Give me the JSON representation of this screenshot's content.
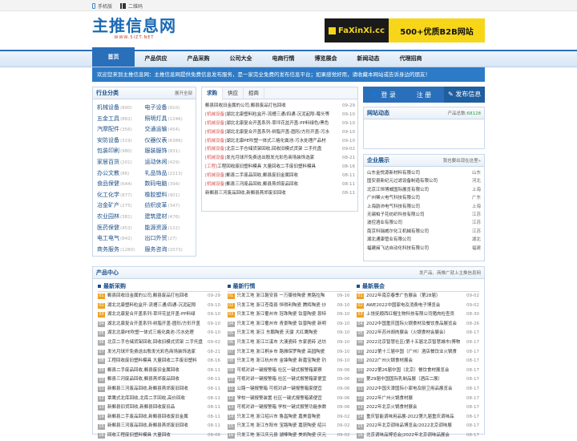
{
  "topbar": {
    "mobile": "手机版",
    "qrcode": "二维码"
  },
  "logo": {
    "title": "主推信息网",
    "sub": "WWW.5IZT.NET"
  },
  "ad": {
    "brand": "FaXinXi.cc",
    "text": "500+优质B2B网站"
  },
  "nav": [
    "首页",
    "产品供应",
    "产品采购",
    "公司大全",
    "电商行情",
    "博览展会",
    "新闻动态",
    "代理招商"
  ],
  "notice": "欢迎您来到主推信息网：主推信息网提供免费信息发布服务，是一家完全免费的发布信息平台；如果感觉好用，请收藏本网站或告诉身边的朋友！",
  "category": {
    "title": "行业分类",
    "more": "展开全部",
    "items": [
      {
        "n": "机械设备",
        "c": "(800)"
      },
      {
        "n": "电子设备",
        "c": "(910)"
      },
      {
        "n": "五金工具",
        "c": "(882)"
      },
      {
        "n": "照明灯具",
        "c": "(1246)"
      },
      {
        "n": "汽摩配件",
        "c": "(356)"
      },
      {
        "n": "交通运输",
        "c": "(454)"
      },
      {
        "n": "安防设备",
        "c": "(319)"
      },
      {
        "n": "仪器仪表",
        "c": "(6386)"
      },
      {
        "n": "包装印刷",
        "c": "(980)"
      },
      {
        "n": "服装服饰",
        "c": "(831)"
      },
      {
        "n": "家居百货",
        "c": "(201)"
      },
      {
        "n": "运动休闲",
        "c": "(429)"
      },
      {
        "n": "办公文教",
        "c": "(86)"
      },
      {
        "n": "礼品饰品",
        "c": "(2213)"
      },
      {
        "n": "食品保健",
        "c": "(644)"
      },
      {
        "n": "数码电脑",
        "c": "(394)"
      },
      {
        "n": "化工化学",
        "c": "(877)"
      },
      {
        "n": "橡胶塑料",
        "c": "(901)"
      },
      {
        "n": "冶金矿产",
        "c": "(275)"
      },
      {
        "n": "纺织皮革",
        "c": "(347)"
      },
      {
        "n": "农业园林",
        "c": "(381)"
      },
      {
        "n": "建筑建材",
        "c": "(476)"
      },
      {
        "n": "医药保健",
        "c": "(452)"
      },
      {
        "n": "能源资源",
        "c": "(122)"
      },
      {
        "n": "电工电气",
        "c": "(842)"
      },
      {
        "n": "出口外贸",
        "c": "(27)"
      },
      {
        "n": "商务服务",
        "c": "(1280)"
      },
      {
        "n": "服务咨询",
        "c": "(2073)"
      }
    ]
  },
  "middle": {
    "tabs": [
      "求购",
      "供应",
      "招商"
    ],
    "items": [
      {
        "tag": "",
        "t": "郵县回收旧金属的公司,郵县废品打包回收",
        "d": "09-29"
      },
      {
        "tag": "[机械设备]",
        "t": "湖北北康塑料粒盒开-流槽三通/四通-沉泥起隙-莓头等",
        "d": "09-10"
      },
      {
        "tag": "[机械设备]",
        "t": "湖北北康复合开盖系列-草坪花盆开盖-PP料绿色/黑色",
        "d": "09-10"
      },
      {
        "tag": "[机械设备]",
        "t": "湖北北康复合开盖系列-树脂开盖-圆形/方形开盖-污水",
        "d": "09-10"
      },
      {
        "tag": "[机械设备]",
        "t": "湖北北康PE吹塑一体式三格化粪池-污水处理产品材",
        "d": "09-10"
      },
      {
        "tag": "[机械设备]",
        "t": "北京二手仓储货架回收,回收旧模式货架  二手托盘",
        "d": "09-02"
      },
      {
        "tag": "[机械设备]",
        "t": "发光月球开免费送出殷发光彩色商场装饰选家",
        "d": "08-21"
      },
      {
        "tag": "[工程]",
        "t": "工程回收废旧塑料模具 大量回收二手废旧塑料模具",
        "d": "08-16"
      },
      {
        "tag": "[机械设备]",
        "t": "郵县二手废品回收,郵县废旧金属回收",
        "d": "08-11"
      },
      {
        "tag": "[机械设备]",
        "t": "郵县三河废品回收,郵县燕郊废品回收",
        "d": "08-11"
      },
      {
        "tag": "",
        "t": "新郵县三河废品回收,新郵县燕郊废旧回收",
        "d": "08-11"
      }
    ]
  },
  "right": {
    "login": "登 录",
    "register": "注 册",
    "publish": "发布信息",
    "dynamic": {
      "title": "网站动态",
      "count_label": "产品总数:",
      "count": "68128"
    },
    "enterprise": {
      "title": "企业展示",
      "more": "我也要出现在这里»",
      "items": [
        {
          "n": "山东金悦源新材料有限公司",
          "p": "山东"
        },
        {
          "n": "国安县新纪元过滤设备制造有限公司",
          "p": "河北"
        },
        {
          "n": "北京江恒博威国际展览有限公司",
          "p": "上海"
        },
        {
          "n": "广州稀火电气科技有限公司",
          "p": "广东"
        },
        {
          "n": "上海韵沛电气科技有限公司",
          "p": "上海"
        },
        {
          "n": "无锡柏子花纺织科技有限公司",
          "p": "江苏"
        },
        {
          "n": "波控酒业有限公司",
          "p": "江苏"
        },
        {
          "n": "南京科瑞威尔化工机械有限公司",
          "p": "江苏"
        },
        {
          "n": "湖北通康管业有限公司",
          "p": "湖北"
        },
        {
          "n": "福建闽飞达自动化科技有限公司",
          "p": "福建"
        }
      ]
    }
  },
  "products": {
    "title": "产品中心",
    "more": "发产品、商推广就上主推信息网",
    "cols": [
      {
        "title": "最新采购",
        "items": [
          {
            "t": "郵县回收旧金属的公司,郵县废品打包回收",
            "d": "09-29"
          },
          {
            "t": "湖北北康塑料粒盒开-流槽三通/四通-沉泥起隙",
            "d": "09-10"
          },
          {
            "t": "湖北北康复合开盖系列-草坪花盆开盖-PP料绿",
            "d": "09-10"
          },
          {
            "t": "湖北北康复合开盖系列-树脂开盖-圆形/方形开盖",
            "d": "09-10"
          },
          {
            "t": "湖北北康PE吹塑一体式三格化粪池-污水处理",
            "d": "09-10"
          },
          {
            "t": "北京二手仓储货架回收,回收旧模式货架  二手托盘",
            "d": "09-02"
          },
          {
            "t": "发光月球开免费送出殷发光彩色商场装饰选家",
            "d": "08-21"
          },
          {
            "t": "工程回收废旧塑料模具 大量回收二手废旧塑料",
            "d": "08-16"
          },
          {
            "t": "郵县二手废品回收,郵县废旧金属回收",
            "d": "08-11"
          },
          {
            "t": "郵县三河废品回收,郵县燕郊废品回收",
            "d": "08-11"
          },
          {
            "t": "新郵县三河废品回收,新郵县燕郊废旧回收",
            "d": "08-11"
          },
          {
            "t": "覃鹰式北库回收,北库二手回收,高价回收",
            "d": "08-11"
          },
          {
            "t": "新郵县旧货回收,新郵县回收废旧品",
            "d": "08-11"
          },
          {
            "t": "新郵县二手废品回收,新郵县回收废旧金属",
            "d": "08-11"
          },
          {
            "t": "新郵县三河废品回收,新郵县燕郊废旧回收",
            "d": "08-11"
          },
          {
            "t": "回收工程废旧塑料模具 大量回收",
            "d": "08-06"
          }
        ]
      },
      {
        "title": "最新行情",
        "items": [
          {
            "t": "只发工地 浙江磐安县 一万瓣技陶瓷 美路拉陶",
            "d": "09-16"
          },
          {
            "t": "只发工地 浙江苍南县 恒得利陶瓷 腾辉陶瓷 炒",
            "d": "09-10"
          },
          {
            "t": "只发工地 浙江衢州市 冠珠陶瓷 钛普陶瓷 恩特",
            "d": "09-10"
          },
          {
            "t": "只发工地 浙江衢州市 青景陶瓷 钛普陶瓷 新明",
            "d": "09-10"
          },
          {
            "t": "只发工地 浙江 东鹏陶瓷 天骏 大红鹰陶瓷",
            "d": "09-10"
          },
          {
            "t": "只发工地 浙江兰溪市 大澳瓷砖 东家瓷砖 达坊",
            "d": "09-10"
          },
          {
            "t": "只发工地 浙江桐乡市 路雅保罗陶瓷 高园陶瓷",
            "d": "09-10"
          },
          {
            "t": "只发工地 浙江杭州市 金锋陶瓷 新嘉宝陶瓷 钓",
            "d": "09-10"
          },
          {
            "t": "可视对讲一键报警箱 社区一键式报警箱紧察",
            "d": "09-06"
          },
          {
            "t": "可视对讲一键报警箱 社区一键式报警箱家便宜",
            "d": "09-06"
          },
          {
            "t": "公路一键报警箱 可视对讲一键报警箱家便宜",
            "d": "09-06"
          },
          {
            "t": "学校一键报警装置 社区一键式报警箱紧便宜",
            "d": "09-06"
          },
          {
            "t": "可视对讲一键报警箱 学校一键式报警功能参数",
            "d": "09-06"
          },
          {
            "t": "只发工地 浙江绍兴市 鲁昌陶瓷 嘉美普陶瓷",
            "d": "09-02"
          },
          {
            "t": "只发工地 浙江东阳市 宝路陶瓷 嘉获陶瓷 绍兴",
            "d": "09-02"
          },
          {
            "t": "只发工地 浙江庆元县 湖棒陶瓷 美凯陶瓷 庆元",
            "d": "09-02"
          }
        ]
      },
      {
        "title": "最新展会",
        "items": [
          {
            "t": "2022年南京春季广告展会（第28届）",
            "d": "09-02"
          },
          {
            "t": "AWE2022中国家电及消费电子博览会",
            "d": "09-02"
          },
          {
            "t": "上饶抚顺西红帽生物科技有限公司猪肉检查员",
            "d": "08-30"
          },
          {
            "t": "2022中国重庆国际火锅食材及餐饮食品展览会",
            "d": "08-26"
          },
          {
            "t": "2022年苏州胡肉展会（火锅食材会展会）",
            "d": "08-17"
          },
          {
            "t": "2022北京智慧社区(第十五届北京智慧城市)博物",
            "d": "08-17"
          },
          {
            "t": "2022第十三届中国（广州）酒店餐饮业火锅食",
            "d": "08-17"
          },
          {
            "t": "2022广州火锅食材展会",
            "d": "08-17"
          },
          {
            "t": "2022第26届中国（北京）餐饮食材展览会",
            "d": "08-17"
          },
          {
            "t": "第29届中国国际乳制品展（酒店二展）",
            "d": "08-17"
          },
          {
            "t": "2022中国天津国际小家电及厨卫用品展览会",
            "d": "08-17"
          },
          {
            "t": "2022年广州火锅食材展",
            "d": "08-17"
          },
          {
            "t": "2022年北京火锅食材展会",
            "d": "08-17"
          },
          {
            "t": "重庆智能调味用品展-2022第九届重庆调味品",
            "d": "08-17"
          },
          {
            "t": "2022年北京调味品博览会/2022北京调味展",
            "d": "08-17"
          },
          {
            "t": "北京调味品博览会|2022年北京调味品展会",
            "d": "08-17"
          }
        ]
      }
    ]
  }
}
